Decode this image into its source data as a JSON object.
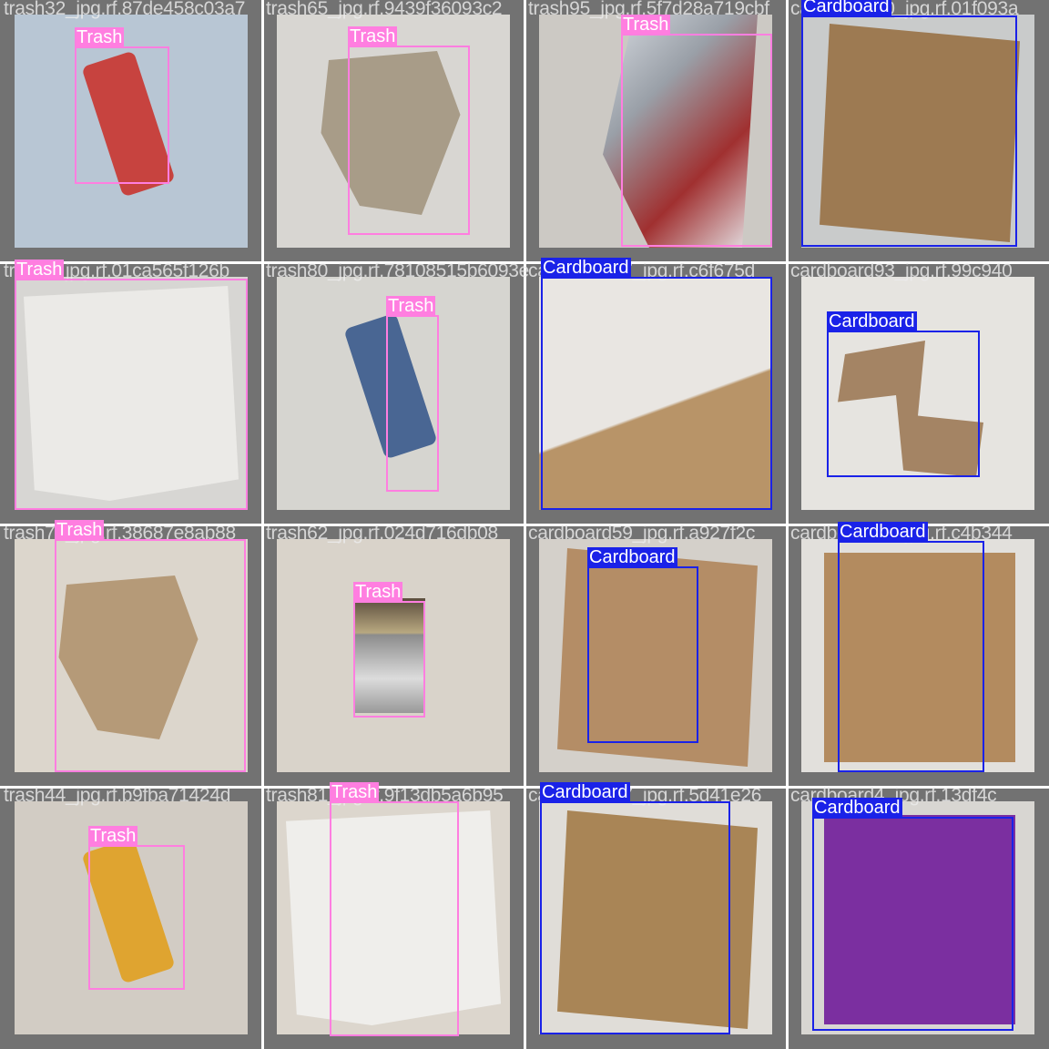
{
  "grid": {
    "columns": 4,
    "rows": 4
  },
  "class_colors": {
    "Trash": "#ff7ee0",
    "Cardboard": "#1a22e8"
  },
  "tiles": [
    {
      "filename": "trash32_jpg.rf.87de458c03a7",
      "label": "Trash",
      "bg": "#b8c6d4",
      "objColor": "#c9342f",
      "obj": "wrapper"
    },
    {
      "filename": "trash65_jpg.rf.9439f36093c2",
      "label": "Trash",
      "bg": "#d8d6d2",
      "objColor": "#a89c88",
      "obj": "paper"
    },
    {
      "filename": "trash95_jpg.rf.5f7d28a719cbf",
      "label": "Trash",
      "bg": "#ccc9c4",
      "objColor": "#9aa0a8",
      "obj": "foil"
    },
    {
      "filename": "cardboard70_jpg.rf.01f093a",
      "label": "Cardboard",
      "bg": "#c9cbcb",
      "objColor": "#9d7a52",
      "obj": "box"
    },
    {
      "filename": "trash6_jpg.rf.01ca565f126b",
      "label": "Trash",
      "bg": "#d7d6d3",
      "objColor": "#ebeae7",
      "obj": "sheet"
    },
    {
      "filename": "trash80_jpg.rf.78108515b6093e",
      "label": "Trash",
      "bg": "#d6d5d0",
      "objColor": "#3a5a8c",
      "obj": "wrapper"
    },
    {
      "filename": "cardboard77_jpg.rf.c6f675d",
      "label": "Cardboard",
      "bg": "#b8b1a8",
      "objColor": "#e9e6e2",
      "obj": "whitebox"
    },
    {
      "filename": "cardboard93_jpg.rf.99c940",
      "label": "Cardboard",
      "bg": "#e6e4e0",
      "objColor": "#a48464",
      "obj": "bent"
    },
    {
      "filename": "trash72_jpg.rf.38687e8ab88",
      "label": "Trash",
      "bg": "#dcd6cc",
      "objColor": "#b59a78",
      "obj": "paper"
    },
    {
      "filename": "trash62_jpg.rf.024d716db08",
      "label": "Trash",
      "bg": "#d9d3ca",
      "objColor": "#8c8c8c",
      "obj": "foilpack"
    },
    {
      "filename": "cardboard59_jpg.rf.a927f2c",
      "label": "Cardboard",
      "bg": "#d4d0ca",
      "objColor": "#b48d66",
      "obj": "box"
    },
    {
      "filename": "cardboard31_jpg.rf.c4b344",
      "label": "Cardboard",
      "bg": "#e2e0dc",
      "objColor": "#b38b5f",
      "obj": "flat"
    },
    {
      "filename": "trash44_jpg.rf.b9fba71424d",
      "label": "Trash",
      "bg": "#d2ccc4",
      "objColor": "#e0a020",
      "obj": "wrapper"
    },
    {
      "filename": "trash81_jpg.rf.9f13db5a6b95",
      "label": "Trash",
      "bg": "#dcd6cd",
      "objColor": "#efeeeb",
      "obj": "sheet"
    },
    {
      "filename": "cardboard87_jpg.rf.5d41e26",
      "label": "Cardboard",
      "bg": "#e0ddd8",
      "objColor": "#a98556",
      "obj": "box"
    },
    {
      "filename": "cardboard4_jpg.rf.13df4c",
      "label": "Cardboard",
      "bg": "#d8d6d2",
      "objColor": "#7b2fa0",
      "obj": "flat"
    }
  ]
}
